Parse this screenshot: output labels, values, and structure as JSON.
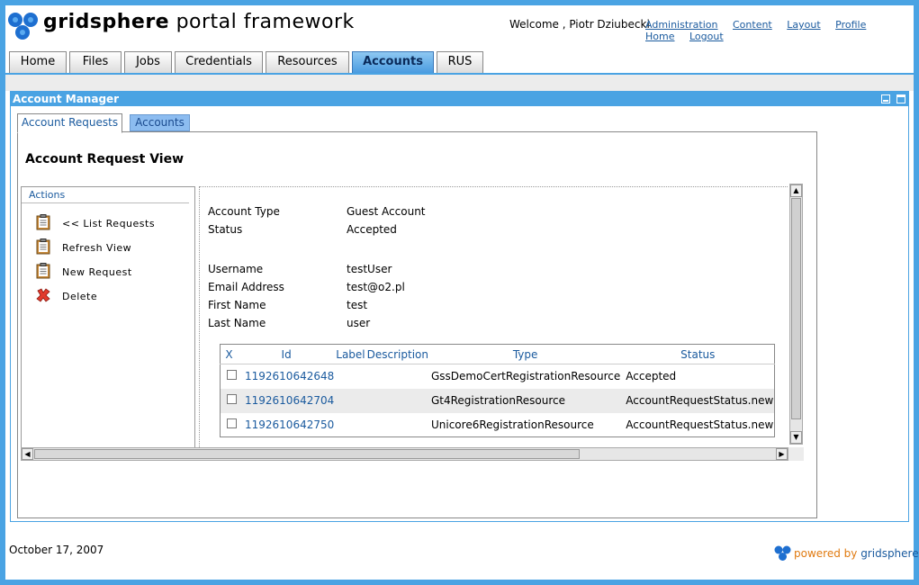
{
  "brand": {
    "strong": "gridsphere",
    "rest": " portal framework"
  },
  "header": {
    "welcome": "Welcome , Piotr Dziubecki",
    "links": [
      "Administration",
      "Content",
      "Layout",
      "Profile",
      "Home",
      "Logout"
    ]
  },
  "tabs": [
    "Home",
    "Files",
    "Jobs",
    "Credentials",
    "Resources",
    "Accounts",
    "RUS"
  ],
  "active_tab": "Accounts",
  "portlet": {
    "title": "Account Manager",
    "subtabs": [
      "Account Requests",
      "Accounts"
    ],
    "view_title": "Account Request View"
  },
  "actions": {
    "heading": "Actions",
    "items": [
      {
        "label": "<< List Requests",
        "icon": "clipboard-icon"
      },
      {
        "label": "Refresh View",
        "icon": "clipboard-icon"
      },
      {
        "label": "New Request",
        "icon": "clipboard-icon"
      },
      {
        "label": "Delete",
        "icon": "delete-x-icon"
      }
    ]
  },
  "details": {
    "account_type": {
      "label": "Account Type",
      "value": "Guest Account"
    },
    "status": {
      "label": "Status",
      "value": "Accepted"
    },
    "username": {
      "label": "Username",
      "value": "testUser"
    },
    "email": {
      "label": "Email Address",
      "value": "test@o2.pl"
    },
    "first_name": {
      "label": "First Name",
      "value": "test"
    },
    "last_name": {
      "label": "Last Name",
      "value": "user"
    }
  },
  "table": {
    "headers": [
      "X",
      "Id",
      "Label",
      "Description",
      "Type",
      "Status"
    ],
    "rows": [
      {
        "id": "1192610642648",
        "label": "",
        "description": "",
        "type": "GssDemoCertRegistrationResource",
        "status": "Accepted"
      },
      {
        "id": "1192610642704",
        "label": "",
        "description": "",
        "type": "Gt4RegistrationResource",
        "status": "AccountRequestStatus.new"
      },
      {
        "id": "1192610642750",
        "label": "",
        "description": "",
        "type": "Unicore6RegistrationResource",
        "status": "AccountRequestStatus.new"
      }
    ]
  },
  "footer": {
    "date": "October 17, 2007",
    "powered_by": "powered by",
    "powered_name": "gridsphere"
  },
  "colors": {
    "accent": "#4aa3e3",
    "link": "#1a5a9e",
    "powered": "#e07a10"
  }
}
